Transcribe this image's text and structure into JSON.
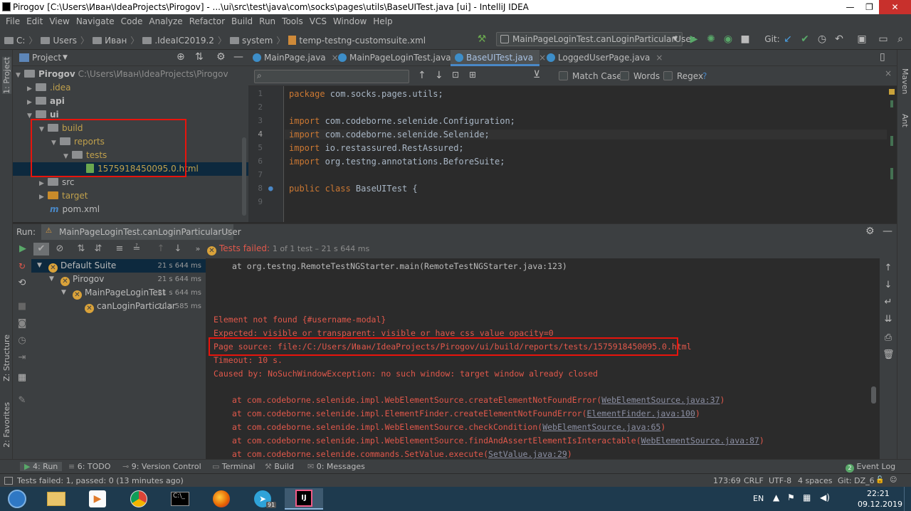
{
  "window": {
    "title": "Pirogov [C:\\Users\\Иван\\IdeaProjects\\Pirogov] - ...\\ui\\src\\test\\java\\com\\socks\\pages\\utils\\BaseUITest.java [ui] - IntelliJ IDEA",
    "minimize": "—",
    "maximize": "❐",
    "close": "✕"
  },
  "menu": [
    "File",
    "Edit",
    "View",
    "Navigate",
    "Code",
    "Analyze",
    "Refactor",
    "Build",
    "Run",
    "Tools",
    "VCS",
    "Window",
    "Help"
  ],
  "breadcrumb": [
    "C:",
    "Users",
    "Иван",
    ".IdeaIC2019.2",
    "system",
    "temp-testng-customsuite.xml"
  ],
  "toolbar": {
    "run_config": "MainPageLoginTest.canLoginParticularUser",
    "git_label": "Git:"
  },
  "left_stripe": {
    "project": "1: Project",
    "structure": "Z: Structure",
    "favorites": "2: Favorites"
  },
  "right_stripe": {
    "maven": "Maven",
    "ant": "Ant"
  },
  "project_panel": {
    "header": "Project",
    "tree": [
      {
        "label": "Pirogov",
        "path": "C:\\Users\\Иван\\IdeaProjects\\Pirogov"
      },
      {
        "label": ".idea"
      },
      {
        "label": "api"
      },
      {
        "label": "ui"
      },
      {
        "label": "build"
      },
      {
        "label": "reports"
      },
      {
        "label": "tests"
      },
      {
        "label": "1575918450095.0.html"
      },
      {
        "label": "src"
      },
      {
        "label": "target"
      },
      {
        "label": "pom.xml"
      }
    ]
  },
  "editor": {
    "tabs": [
      "MainPage.java",
      "MainPageLoginTest.java",
      "BaseUITest.java",
      "LoggedUserPage.java"
    ],
    "find": {
      "match_case": "Match Case",
      "words": "Words",
      "regex": "Regex",
      "help": "?"
    },
    "lines": [
      {
        "n": "1",
        "kw": "package",
        "rest": " com.socks.pages.utils;"
      },
      {
        "n": "2",
        "kw": "",
        "rest": ""
      },
      {
        "n": "3",
        "kw": "import",
        "rest": " com.codeborne.selenide.Configuration;"
      },
      {
        "n": "4",
        "kw": "import",
        "rest": " com.codeborne.selenide.Selenide;"
      },
      {
        "n": "5",
        "kw": "import",
        "rest": " io.restassured.RestAssured;"
      },
      {
        "n": "6",
        "kw": "import",
        "rest": " org.testng.annotations.BeforeSuite;"
      },
      {
        "n": "7",
        "kw": "",
        "rest": ""
      },
      {
        "n": "8",
        "kw": "public class",
        "rest": " BaseUITest {"
      },
      {
        "n": "9",
        "kw": "",
        "rest": ""
      }
    ]
  },
  "run_panel": {
    "label": "Run:",
    "tab": "MainPageLoginTest.canLoginParticularUser",
    "status_failed": "Tests failed:",
    "status_rest": "1 of 1 test – 21 s 644 ms",
    "tree": [
      {
        "label": "Default Suite",
        "time": "21 s 644 ms"
      },
      {
        "label": "Pirogov",
        "time": "21 s 644 ms"
      },
      {
        "label": "MainPageLoginTest",
        "time": "21 s 644 ms"
      },
      {
        "label": "canLoginParticular",
        "time": "20 s 585 ms"
      }
    ],
    "console": {
      "trace_top": "at org.testng.RemoteTestNGStarter.main(RemoteTestNGStarter.java:123)",
      "err1": "Element not found {#username-modal}",
      "err2": "Expected: visible or transparent: visible or have css value opacity=0",
      "err3": "Page source: file:/C:/Users/Иван/IdeaProjects/Pirogov/ui/build/reports/tests/1575918450095.0.html",
      "err4": "Timeout: 10 s.",
      "err5": "Caused by: NoSuchWindowException: no such window: target window already closed",
      "stack": [
        {
          "pre": "at com.codeborne.selenide.impl.WebElementSource.createElementNotFoundError(",
          "link": "WebElementSource.java:37",
          "post": ")"
        },
        {
          "pre": "at com.codeborne.selenide.impl.ElementFinder.createElementNotFoundError(",
          "link": "ElementFinder.java:100",
          "post": ")"
        },
        {
          "pre": "at com.codeborne.selenide.impl.WebElementSource.checkCondition(",
          "link": "WebElementSource.java:65",
          "post": ")"
        },
        {
          "pre": "at com.codeborne.selenide.impl.WebElementSource.findAndAssertElementIsInteractable(",
          "link": "WebElementSource.java:87",
          "post": ")"
        },
        {
          "pre": "at com.codeborne.selenide.commands.SetValue.execute(",
          "link": "SetValue.java:29",
          "post": ")"
        }
      ]
    }
  },
  "tool_windows": {
    "run": "4: Run",
    "todo": "6: TODO",
    "vc": "9: Version Control",
    "terminal": "Terminal",
    "build": "Build",
    "messages": "0: Messages",
    "event_log": "Event Log",
    "event_badge": "2"
  },
  "status_bar": {
    "message": "Tests failed: 1, passed: 0 (13 minutes ago)",
    "position": "173:69",
    "line_sep": "CRLF",
    "encoding": "UTF-8",
    "indent": "4 spaces",
    "git": "Git: DZ_6"
  },
  "taskbar": {
    "lang": "EN",
    "time": "22:21",
    "date": "09.12.2019",
    "telegram_badge": "91"
  }
}
